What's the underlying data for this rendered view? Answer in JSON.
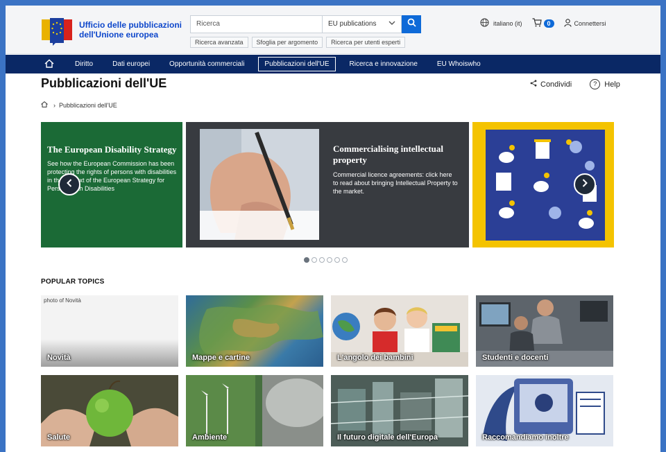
{
  "header": {
    "logo_line1": "Ufficio delle pubblicazioni",
    "logo_line2": "dell'Unione europea",
    "search_placeholder": "Ricerca",
    "search_scope": "EU publications",
    "search_links": [
      "Ricerca avanzata",
      "Sfoglia per argomento",
      "Ricerca per utenti esperti"
    ],
    "language": "italiano (it)",
    "cart_count": "0",
    "login": "Connettersi"
  },
  "nav": {
    "items": [
      "Diritto",
      "Dati europei",
      "Opportunità commerciali",
      "Pubblicazioni dell'UE",
      "Ricerca e innovazione",
      "EU Whoiswho"
    ],
    "active_index": 3
  },
  "page": {
    "title": "Pubblicazioni dell'UE",
    "share": "Condividi",
    "help": "Help",
    "breadcrumb": "Pubblicazioni dell'UE"
  },
  "carousel": {
    "slide1_title": "The European Disability Strategy",
    "slide1_text": "See how the European Commission has been protecting the rights of persons with disabilities in the context of the European Strategy for Persons with Disabilities",
    "slide2_title": "Commercialising intellectual property",
    "slide2_text": "Commercial licence agreements: click here to read about bringing Intellectual Property to the market.",
    "dot_count": 6,
    "active_dot": 0
  },
  "popular": {
    "title": "POPULAR TOPICS",
    "novita_alt": "photo of Novità",
    "tiles": [
      "Novità",
      "Mappe e cartine",
      "L'angolo dei bambini",
      "Studenti e docenti",
      "Salute",
      "Ambiente",
      "Il futuro digitale dell'Europa",
      "Raccomandiamo inoltre"
    ]
  },
  "colors": {
    "frame": "#3b73c4",
    "nav_bg": "#0a2865",
    "accent": "#0e6ad8",
    "slide1_bg": "#1b6a36",
    "slide2_bg": "#383b40",
    "slide3_bg": "#f4c300"
  }
}
